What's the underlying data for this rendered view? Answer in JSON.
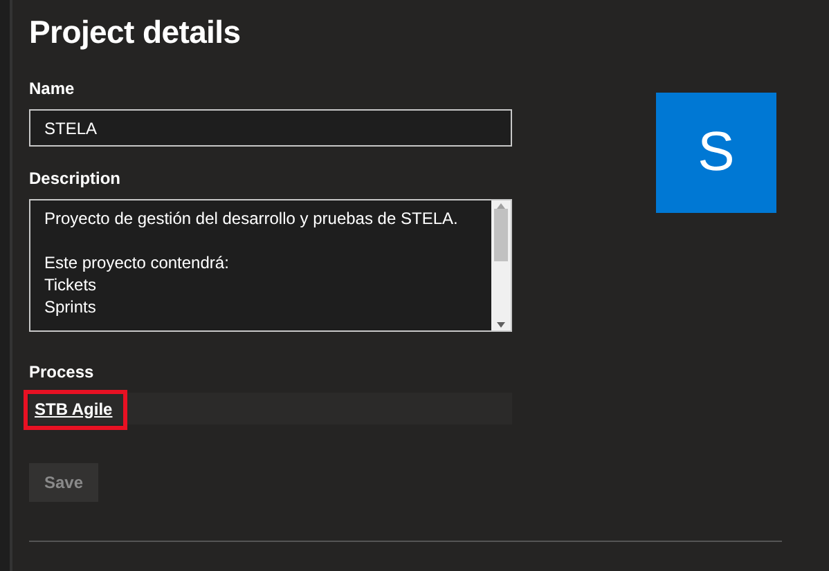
{
  "title": "Project details",
  "name": {
    "label": "Name",
    "value": "STELA"
  },
  "avatar": {
    "letter": "S",
    "color": "#0078d4"
  },
  "description": {
    "label": "Description",
    "paragraphs": [
      [
        "Proyecto de gestión del desarrollo y pruebas de STELA."
      ],
      [
        "Este proyecto contendrá:",
        "Tickets",
        "Sprints"
      ]
    ]
  },
  "process": {
    "label": "Process",
    "value": "STB Agile",
    "highlighted": true
  },
  "buttons": [
    {
      "label": "Save",
      "disabled": true
    }
  ]
}
